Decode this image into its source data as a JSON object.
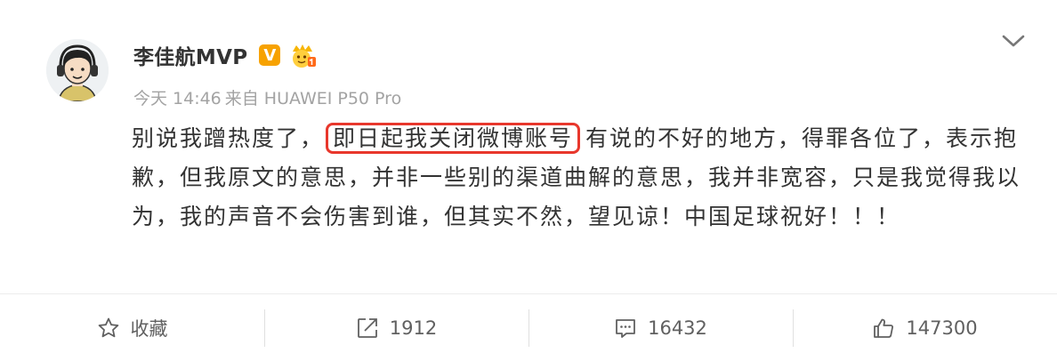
{
  "post": {
    "username": "李佳航MVP",
    "verified_badge": "V",
    "meta": {
      "time_prefix": "今天",
      "time": "14:46",
      "source_prefix": "来自",
      "source": "HUAWEI P50 Pro"
    },
    "content": {
      "before": "别说我蹭热度了，",
      "highlight": "即日起我关闭微博账号",
      "after": "有说的不好的地方，得罪各位了，表示抱歉，但我原文的意思，并非一些别的渠道曲解的意思，我并非宽容，只是我觉得我以为，我的声音不会伤害到谁，但其实不然，望见谅！中国足球祝好！！！"
    }
  },
  "toolbar": {
    "favorite_label": "收藏",
    "repost_count": "1912",
    "comment_count": "16432",
    "like_count": "147300"
  },
  "icons": {
    "more": "chevron-down-icon",
    "favorite": "star-icon",
    "repost": "share-icon",
    "comment": "comment-icon",
    "like": "thumbs-up-icon"
  },
  "colors": {
    "highlight_border": "#e8372c",
    "verified_badge": "#f7a200",
    "meta_text": "#a3a3a3"
  }
}
